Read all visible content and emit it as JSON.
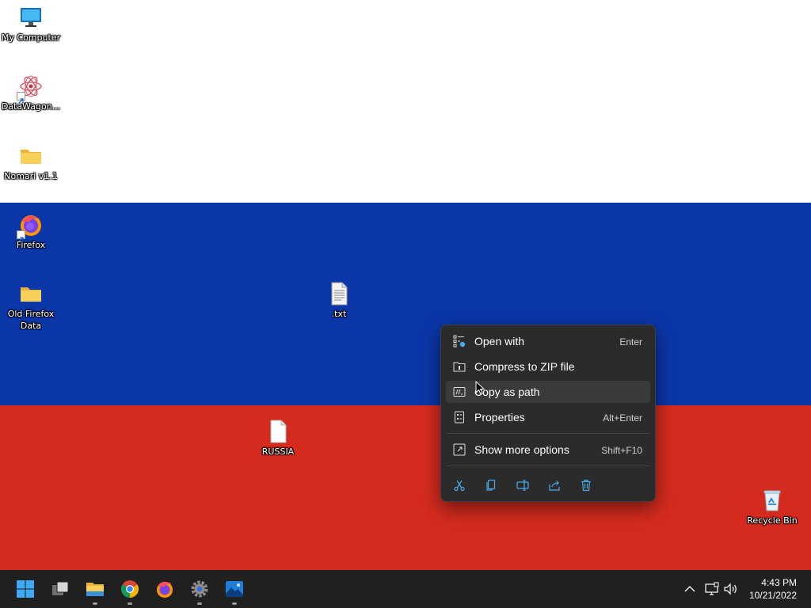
{
  "desktop": {
    "icons": [
      {
        "label": "My Computer",
        "icon": "monitor-icon"
      },
      {
        "label": "DataWagon...",
        "icon": "datawagon-icon"
      },
      {
        "label": "Nomari v1.1",
        "icon": "folder-icon"
      },
      {
        "label": "Firefox",
        "icon": "firefox-icon"
      },
      {
        "label": "Old Firefox Data",
        "icon": "folder-icon"
      },
      {
        "label": ".txt",
        "icon": "text-file-icon"
      },
      {
        "label": "RUSSIA",
        "icon": "blank-file-icon"
      },
      {
        "label": "Recycle Bin",
        "icon": "recycle-bin-icon"
      }
    ],
    "colors": {
      "white": "#ffffff",
      "blue": "#0b36a8",
      "red": "#d52b1e"
    }
  },
  "context_menu": {
    "items": [
      {
        "label": "Open with",
        "shortcut": "Enter",
        "icon": "open-with-icon"
      },
      {
        "label": "Compress to ZIP file",
        "shortcut": "",
        "icon": "zip-icon"
      },
      {
        "label": "Copy as path",
        "shortcut": "",
        "icon": "copy-path-icon"
      },
      {
        "label": "Properties",
        "shortcut": "Alt+Enter",
        "icon": "properties-icon"
      },
      {
        "label": "Show more options",
        "shortcut": "Shift+F10",
        "icon": "more-options-icon"
      }
    ],
    "toolbar": [
      "cut-icon",
      "copy-icon",
      "rename-icon",
      "share-icon",
      "delete-icon"
    ]
  },
  "taskbar": {
    "apps": [
      "start-icon",
      "task-view-icon",
      "file-explorer-icon",
      "chrome-icon",
      "firefox-icon",
      "settings-icon",
      "photos-icon"
    ],
    "tray": [
      "chevron-up-icon",
      "network-icon",
      "volume-icon"
    ],
    "time": "4:43 PM",
    "date": "10/21/2022"
  }
}
